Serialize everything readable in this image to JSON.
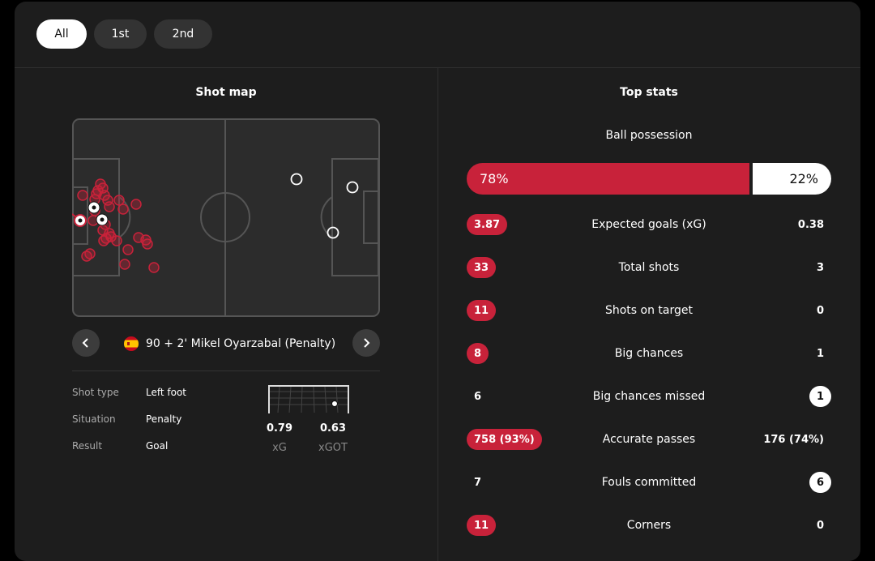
{
  "periods": [
    "All",
    "1st",
    "2nd"
  ],
  "shot_map": {
    "title": "Shot map",
    "selected_shot": "90 + 2' Mikel Oyarzabal (Penalty)",
    "details": [
      {
        "label": "Shot type",
        "value": "Left foot"
      },
      {
        "label": "Situation",
        "value": "Penalty"
      },
      {
        "label": "Result",
        "value": "Goal"
      }
    ],
    "xg": {
      "value": "0.79",
      "label": "xG"
    },
    "xgot": {
      "value": "0.63",
      "label": "xGOT"
    }
  },
  "top_stats": {
    "title": "Top stats",
    "possession": {
      "label": "Ball possession",
      "home": "78%",
      "away": "22%",
      "home_share": 0.78
    },
    "rows": [
      {
        "label": "Expected goals (xG)",
        "home": "3.87",
        "away": "0.38",
        "highlight": "home"
      },
      {
        "label": "Total shots",
        "home": "33",
        "away": "3",
        "highlight": "home"
      },
      {
        "label": "Shots on target",
        "home": "11",
        "away": "0",
        "highlight": "home"
      },
      {
        "label": "Big chances",
        "home": "8",
        "away": "1",
        "highlight": "home"
      },
      {
        "label": "Big chances missed",
        "home": "6",
        "away": "1",
        "highlight": "away"
      },
      {
        "label": "Accurate passes",
        "home": "758 (93%)",
        "away": "176 (74%)",
        "highlight": "home"
      },
      {
        "label": "Fouls committed",
        "home": "7",
        "away": "6",
        "highlight": "away"
      },
      {
        "label": "Corners",
        "home": "11",
        "away": "0",
        "highlight": "home"
      }
    ]
  },
  "colors": {
    "home": "#c8223a",
    "away": "#ffffff",
    "card": "#1d1d1d"
  }
}
